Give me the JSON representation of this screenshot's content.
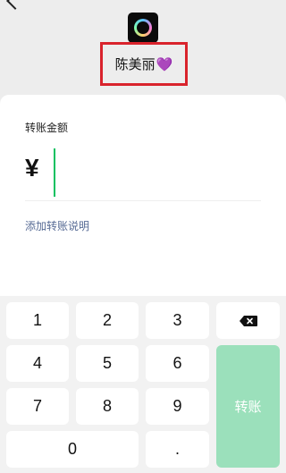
{
  "header": {
    "recipient_name": "陈美丽",
    "heart_emoji": "💜",
    "avatar_icon": "avatar-image",
    "back_icon": "chevron-left-icon"
  },
  "card": {
    "amount_label": "转账金额",
    "currency_symbol": "¥",
    "amount_value": "",
    "add_note_label": "添加转账说明"
  },
  "keypad": {
    "keys": [
      "1",
      "2",
      "3",
      "4",
      "5",
      "6",
      "7",
      "8",
      "9",
      "0",
      "."
    ],
    "backspace_icon": "backspace-icon",
    "transfer_label": "转账"
  },
  "colors": {
    "accent": "#07c160",
    "transfer_disabled": "#9be0bb",
    "highlight_border": "#d9232c",
    "link": "#576b95"
  }
}
